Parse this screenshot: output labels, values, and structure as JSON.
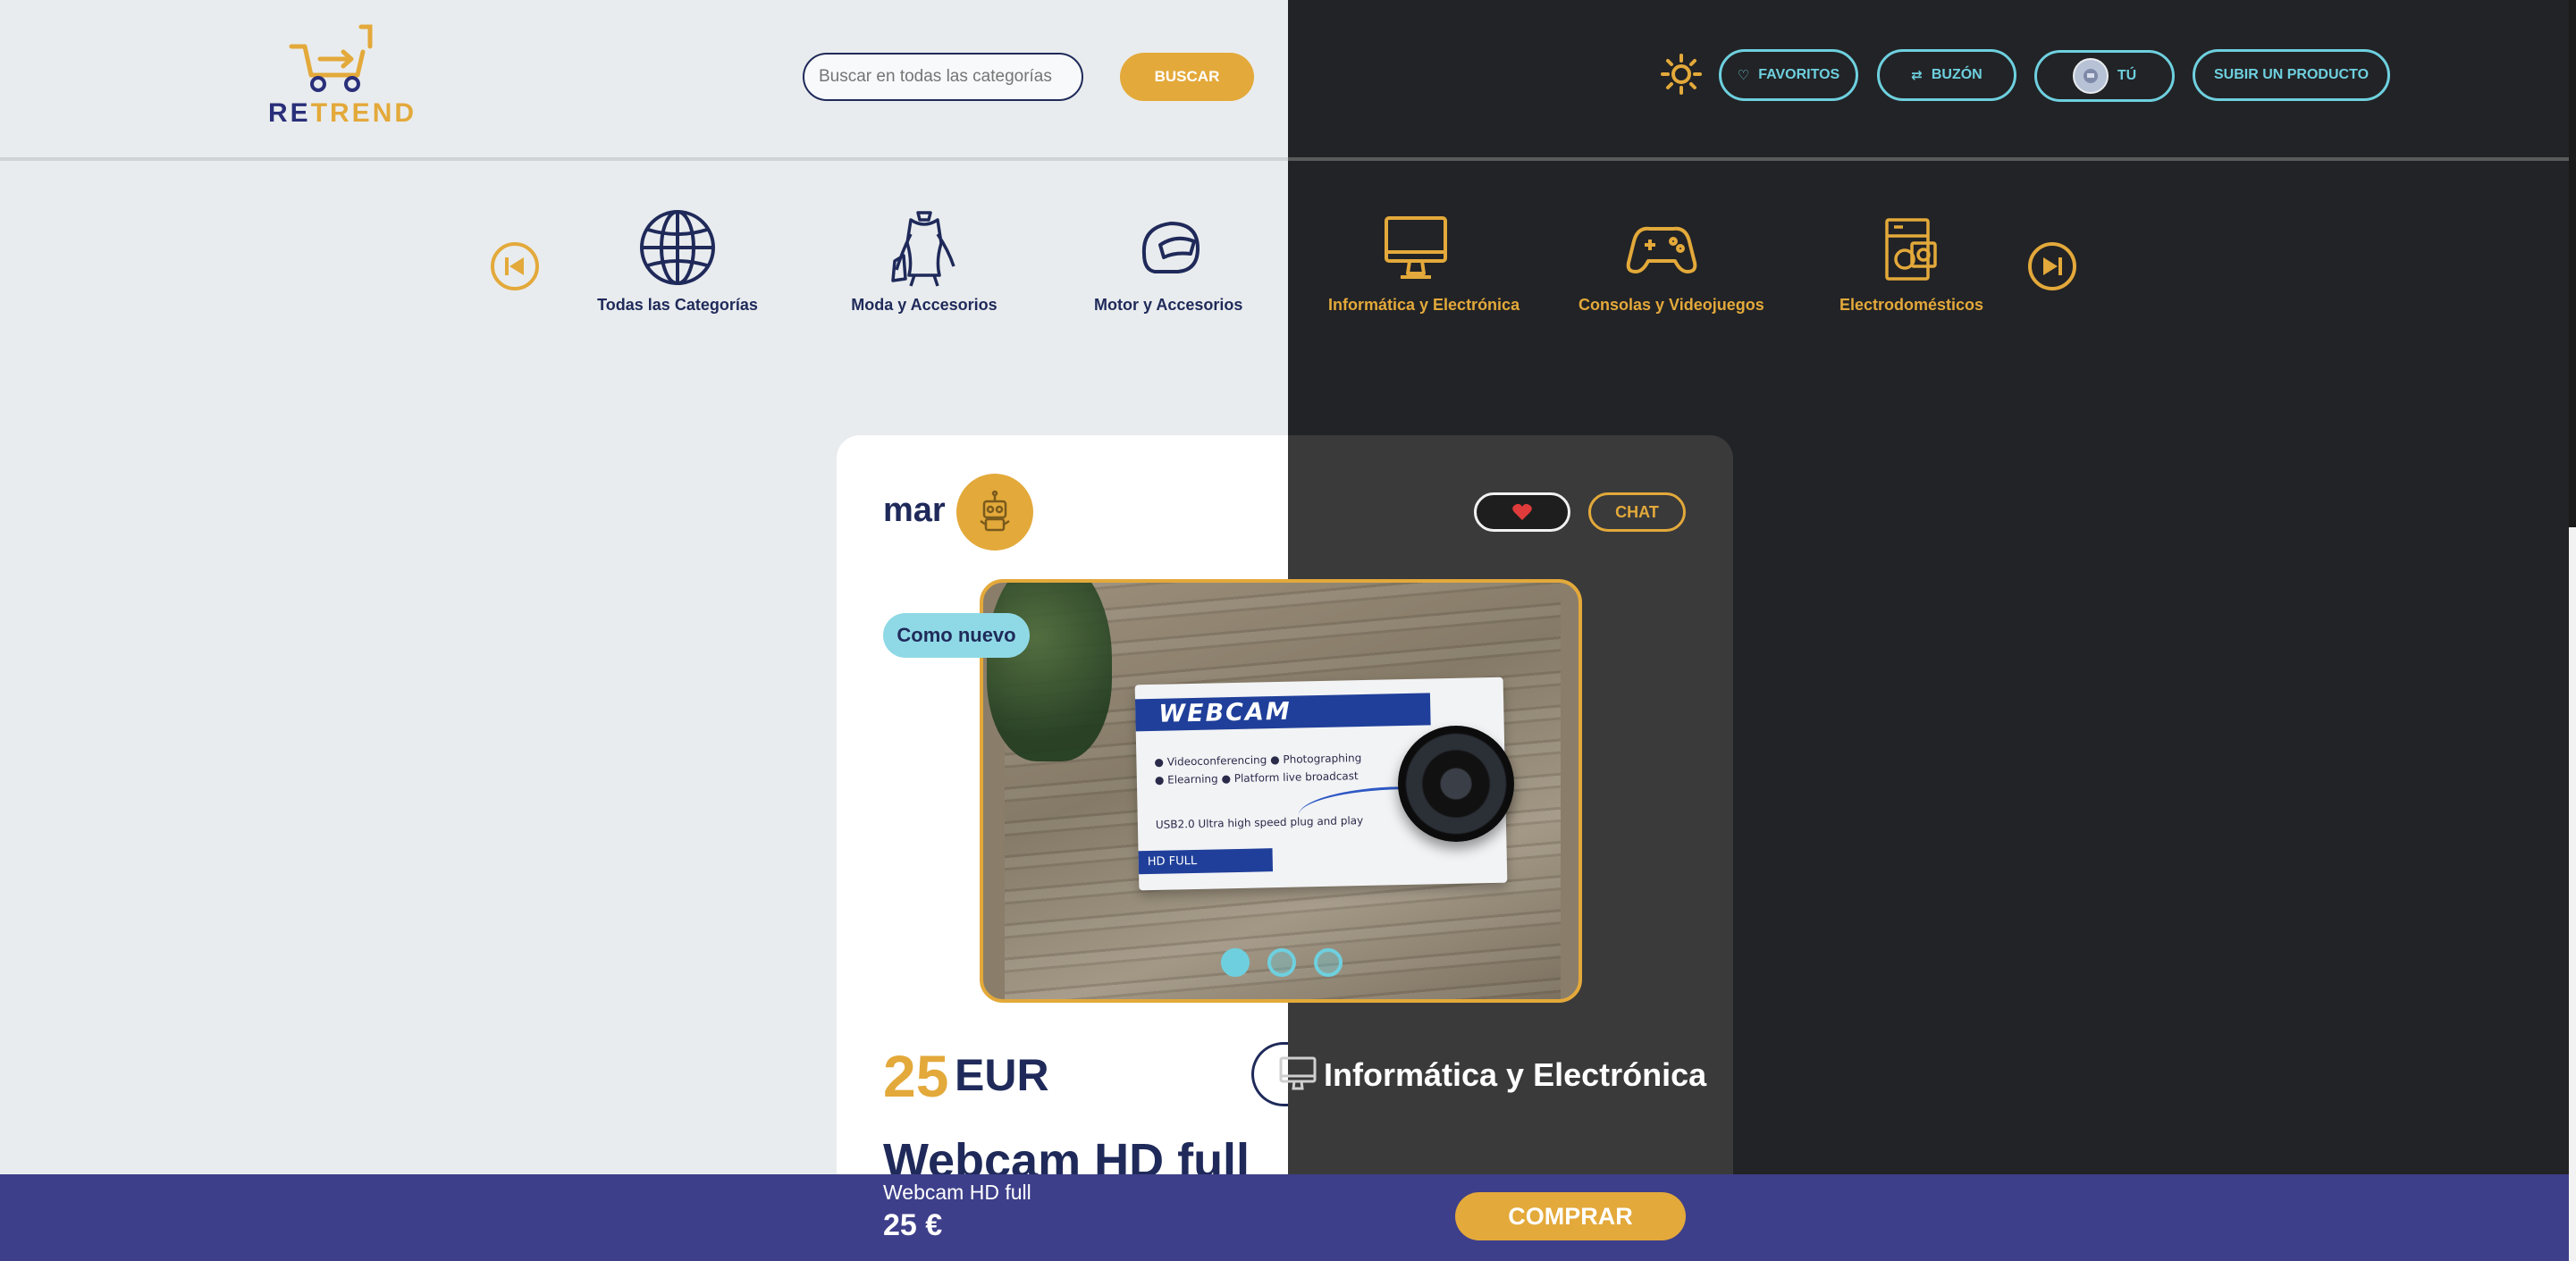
{
  "header": {
    "logo_text_a": "RE",
    "logo_text_b": "TREND",
    "search_placeholder": "Buscar en todas las categorías",
    "search_button": "BUSCAR",
    "favoritos": "FAVORITOS",
    "buzon": "BUZÓN",
    "tu": "TÚ",
    "subir": "SUBIR UN PRODUCTO"
  },
  "categories": [
    {
      "label": "Todas las Categorías",
      "icon": "globe-icon"
    },
    {
      "label": "Moda y Accesorios",
      "icon": "mannequin-icon"
    },
    {
      "label": "Motor y Accesorios",
      "icon": "helmet-icon"
    },
    {
      "label": "Informática y Electrónica",
      "icon": "monitor-icon"
    },
    {
      "label": "Consolas y Videojuegos",
      "icon": "gamepad-icon"
    },
    {
      "label": "Electrodomésticos",
      "icon": "appliance-icon"
    }
  ],
  "product": {
    "seller": "mar",
    "condition": "Como nuevo",
    "chat": "CHAT",
    "price": "25",
    "currency": "EUR",
    "category": "Informática y Electrónica",
    "title": "Webcam HD full",
    "photo": {
      "box_brand": "WEBCAM",
      "feature_1": "● Videoconferencing   ● Photographing",
      "feature_2": "● Elearning   ● Platform live broadcast",
      "feature_3": "USB2.0   Ultra high speed   plug and play",
      "hd_label": "HD FULL"
    },
    "carousel_dots": 3,
    "active_dot": 1
  },
  "bottom_bar": {
    "title": "Webcam HD full",
    "price": "25 €",
    "buy": "COMPRAR"
  },
  "colors": {
    "accent": "#e3a93a",
    "navy": "#1f2a5a",
    "cyan": "#6ed0df",
    "dark_bg": "#222326",
    "bar": "#3d3f8a"
  }
}
